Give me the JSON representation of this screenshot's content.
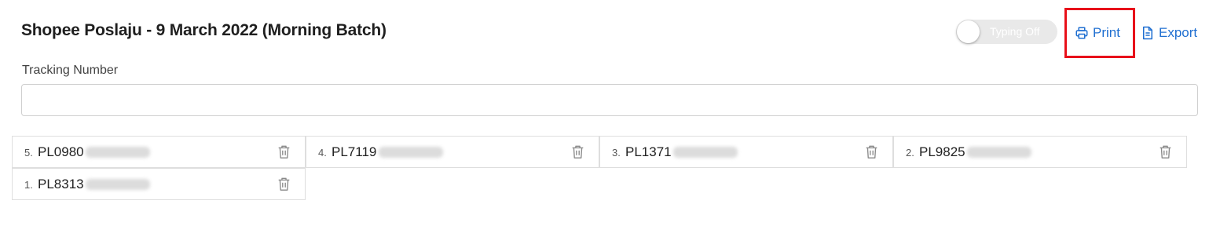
{
  "header": {
    "title": "Shopee Poslaju - 9 March 2022 (Morning Batch)",
    "typing_toggle": {
      "label": "Typing Off",
      "state": "off"
    },
    "print_label": "Print",
    "export_label": "Export"
  },
  "form": {
    "tracking_label": "Tracking Number",
    "tracking_value": ""
  },
  "entries": [
    {
      "index": "5.",
      "number": "PL0980"
    },
    {
      "index": "4.",
      "number": "PL7119"
    },
    {
      "index": "3.",
      "number": "PL1371"
    },
    {
      "index": "2.",
      "number": "PL9825"
    },
    {
      "index": "1.",
      "number": "PL8313"
    }
  ],
  "icons": {
    "print": "printer-icon",
    "export": "document-icon",
    "delete": "trash-icon"
  },
  "colors": {
    "link": "#1f6fd1",
    "highlight": "#e8101a",
    "toggle_off": "#e9e9e9"
  }
}
